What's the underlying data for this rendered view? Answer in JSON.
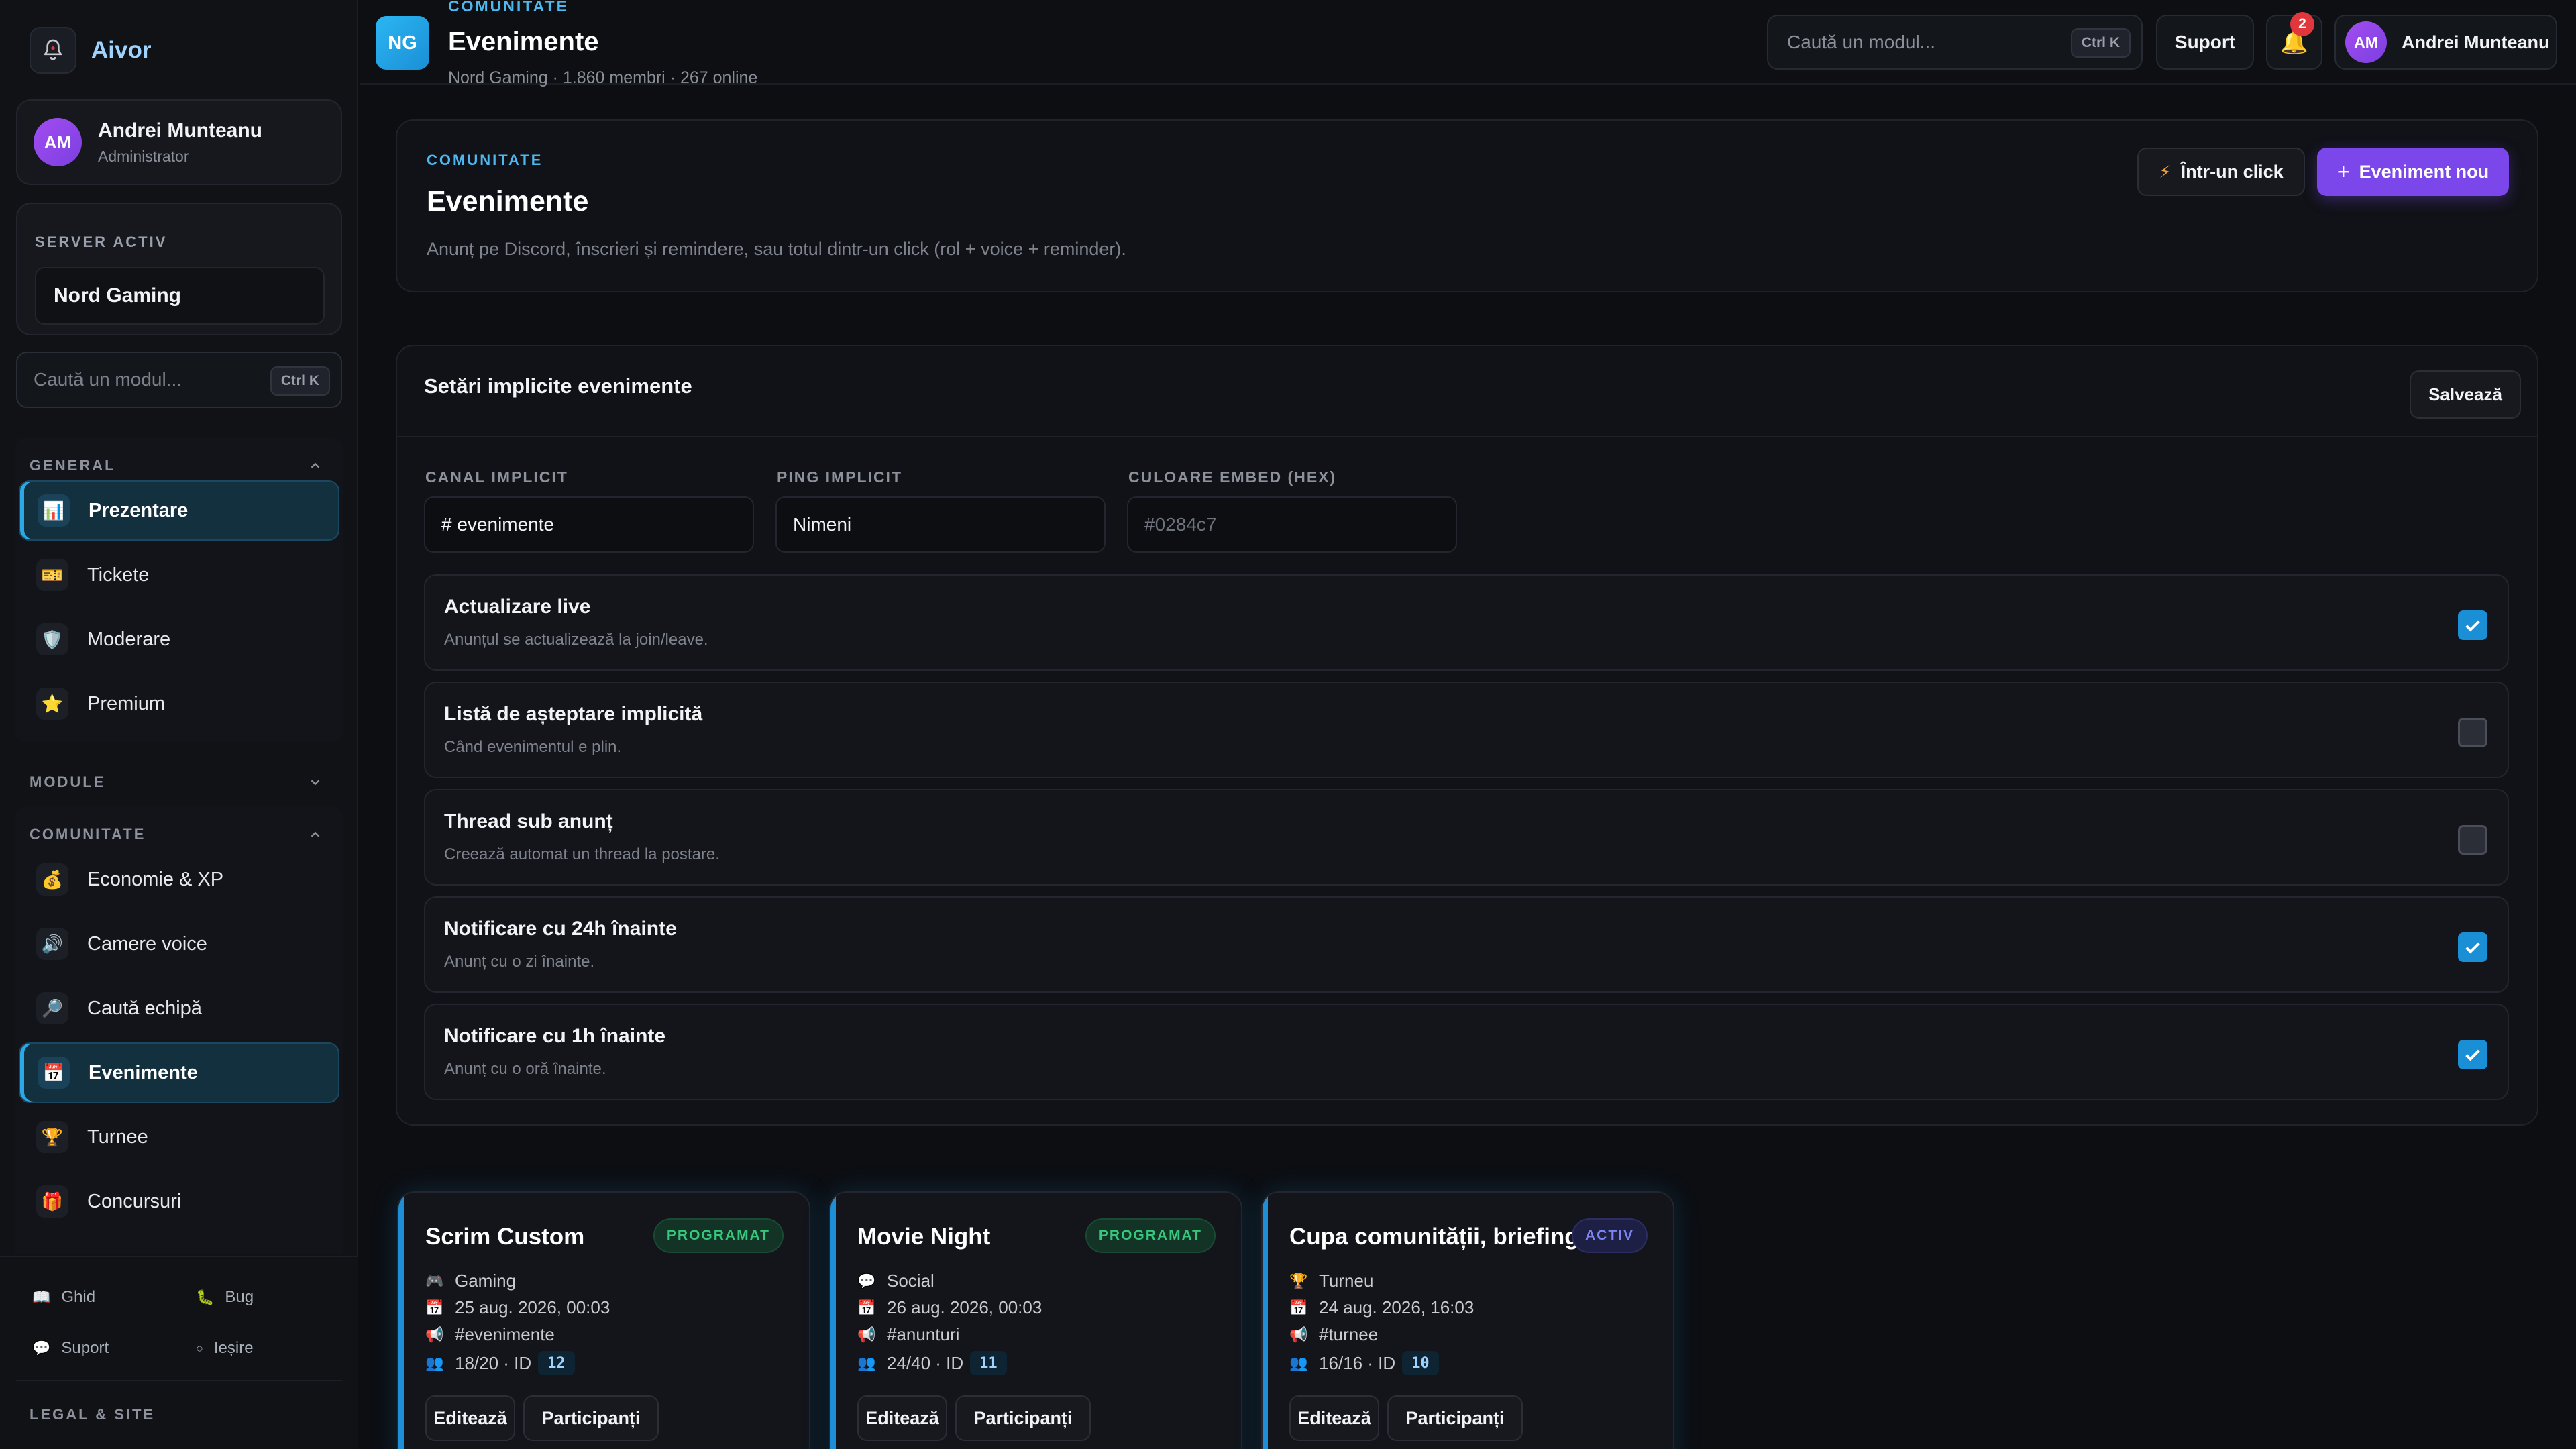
{
  "app": {
    "name": "Aivor",
    "logo_icon": "bell-logo-icon"
  },
  "user": {
    "initials": "AM",
    "name": "Andrei Munteanu",
    "role": "Administrator"
  },
  "server": {
    "label": "SERVER ACTIV",
    "selected": "Nord Gaming"
  },
  "search": {
    "placeholder": "Caută un modul...",
    "shortcut": "Ctrl K"
  },
  "sidebar": {
    "sections": [
      {
        "title": "GENERAL",
        "expanded": true
      },
      {
        "title": "MODULE",
        "expanded": false
      },
      {
        "title": "COMUNITATE",
        "expanded": true
      }
    ],
    "general_items": [
      {
        "label": "Prezentare",
        "icon": "bar-chart-icon",
        "active": true
      },
      {
        "label": "Tickete",
        "icon": "ticket-icon",
        "active": false
      },
      {
        "label": "Moderare",
        "icon": "shield-icon",
        "active": false
      },
      {
        "label": "Premium",
        "icon": "star-icon",
        "active": false
      }
    ],
    "community_items": [
      {
        "label": "Economie & XP",
        "icon": "money-bag-icon",
        "active": false
      },
      {
        "label": "Camere voice",
        "icon": "speaker-icon",
        "active": false
      },
      {
        "label": "Caută echipă",
        "icon": "magnifier-icon",
        "active": false
      },
      {
        "label": "Evenimente",
        "icon": "calendar-icon",
        "active": true
      },
      {
        "label": "Turnee",
        "icon": "trophy-icon",
        "active": false
      },
      {
        "label": "Concursuri",
        "icon": "gift-icon",
        "active": false
      }
    ],
    "footer_links": [
      {
        "label": "Ghid",
        "icon": "book-icon"
      },
      {
        "label": "Bug",
        "icon": "bug-icon"
      },
      {
        "label": "Suport",
        "icon": "chat-icon"
      },
      {
        "label": "Ieșire",
        "icon": "exit-icon"
      }
    ],
    "legal_label": "LEGAL & SITE"
  },
  "topbar": {
    "badge": "NG",
    "kicker": "COMUNITATE",
    "title": "Evenimente",
    "subtitle": "Nord Gaming · 1.860 membri · 267 online",
    "support_label": "Suport",
    "notifications_count": "2",
    "user_initials": "AM",
    "user_name": "Andrei Munteanu"
  },
  "hero": {
    "kicker": "COMUNITATE",
    "title": "Evenimente",
    "description": "Anunț pe Discord, înscrieri și remindere, sau totul dintr-un click (rol + voice + reminder).",
    "quick_button": "Într-un click",
    "new_button": "Eveniment nou"
  },
  "settings": {
    "title": "Setări implicite evenimente",
    "save_label": "Salvează",
    "fields": [
      {
        "label": "CANAL IMPLICIT",
        "value": "# evenimente",
        "placeholder": ""
      },
      {
        "label": "PING IMPLICIT",
        "value": "Nimeni",
        "placeholder": ""
      },
      {
        "label": "CULOARE EMBED (HEX)",
        "value": "",
        "placeholder": "#0284c7"
      }
    ],
    "toggles": [
      {
        "title": "Actualizare live",
        "desc": "Anunțul se actualizează la join/leave.",
        "checked": true
      },
      {
        "title": "Listă de așteptare implicită",
        "desc": "Când evenimentul e plin.",
        "checked": false
      },
      {
        "title": "Thread sub anunț",
        "desc": "Creează automat un thread la postare.",
        "checked": false
      },
      {
        "title": "Notificare cu 24h înainte",
        "desc": "Anunț cu o zi înainte.",
        "checked": true
      },
      {
        "title": "Notificare cu 1h înainte",
        "desc": "Anunț cu o oră înainte.",
        "checked": true
      }
    ]
  },
  "events": [
    {
      "title": "Scrim Custom",
      "status": "PROGRAMAT",
      "status_kind": "sched",
      "category": "Gaming",
      "category_icon": "gamepad-icon",
      "date": "25 aug. 2026, 00:03",
      "channel": "#evenimente",
      "participants": "18/20 · ID",
      "id": "12",
      "edit_label": "Editează",
      "participants_label": "Participanți"
    },
    {
      "title": "Movie Night",
      "status": "PROGRAMAT",
      "status_kind": "sched",
      "category": "Social",
      "category_icon": "chat-icon",
      "date": "26 aug. 2026, 00:03",
      "channel": "#anunturi",
      "participants": "24/40 · ID",
      "id": "11",
      "edit_label": "Editează",
      "participants_label": "Participanți"
    },
    {
      "title": "Cupa comunității, briefing",
      "status": "ACTIV",
      "status_kind": "active",
      "category": "Turneu",
      "category_icon": "trophy-icon",
      "date": "24 aug. 2026, 16:03",
      "channel": "#turnee",
      "participants": "16/16 · ID",
      "id": "10",
      "edit_label": "Editează",
      "participants_label": "Participanți"
    }
  ],
  "colors": {
    "accent": "#1a8fd6",
    "primary": "#7b47ea",
    "success": "#35c77b",
    "badge": "#e0363c"
  }
}
